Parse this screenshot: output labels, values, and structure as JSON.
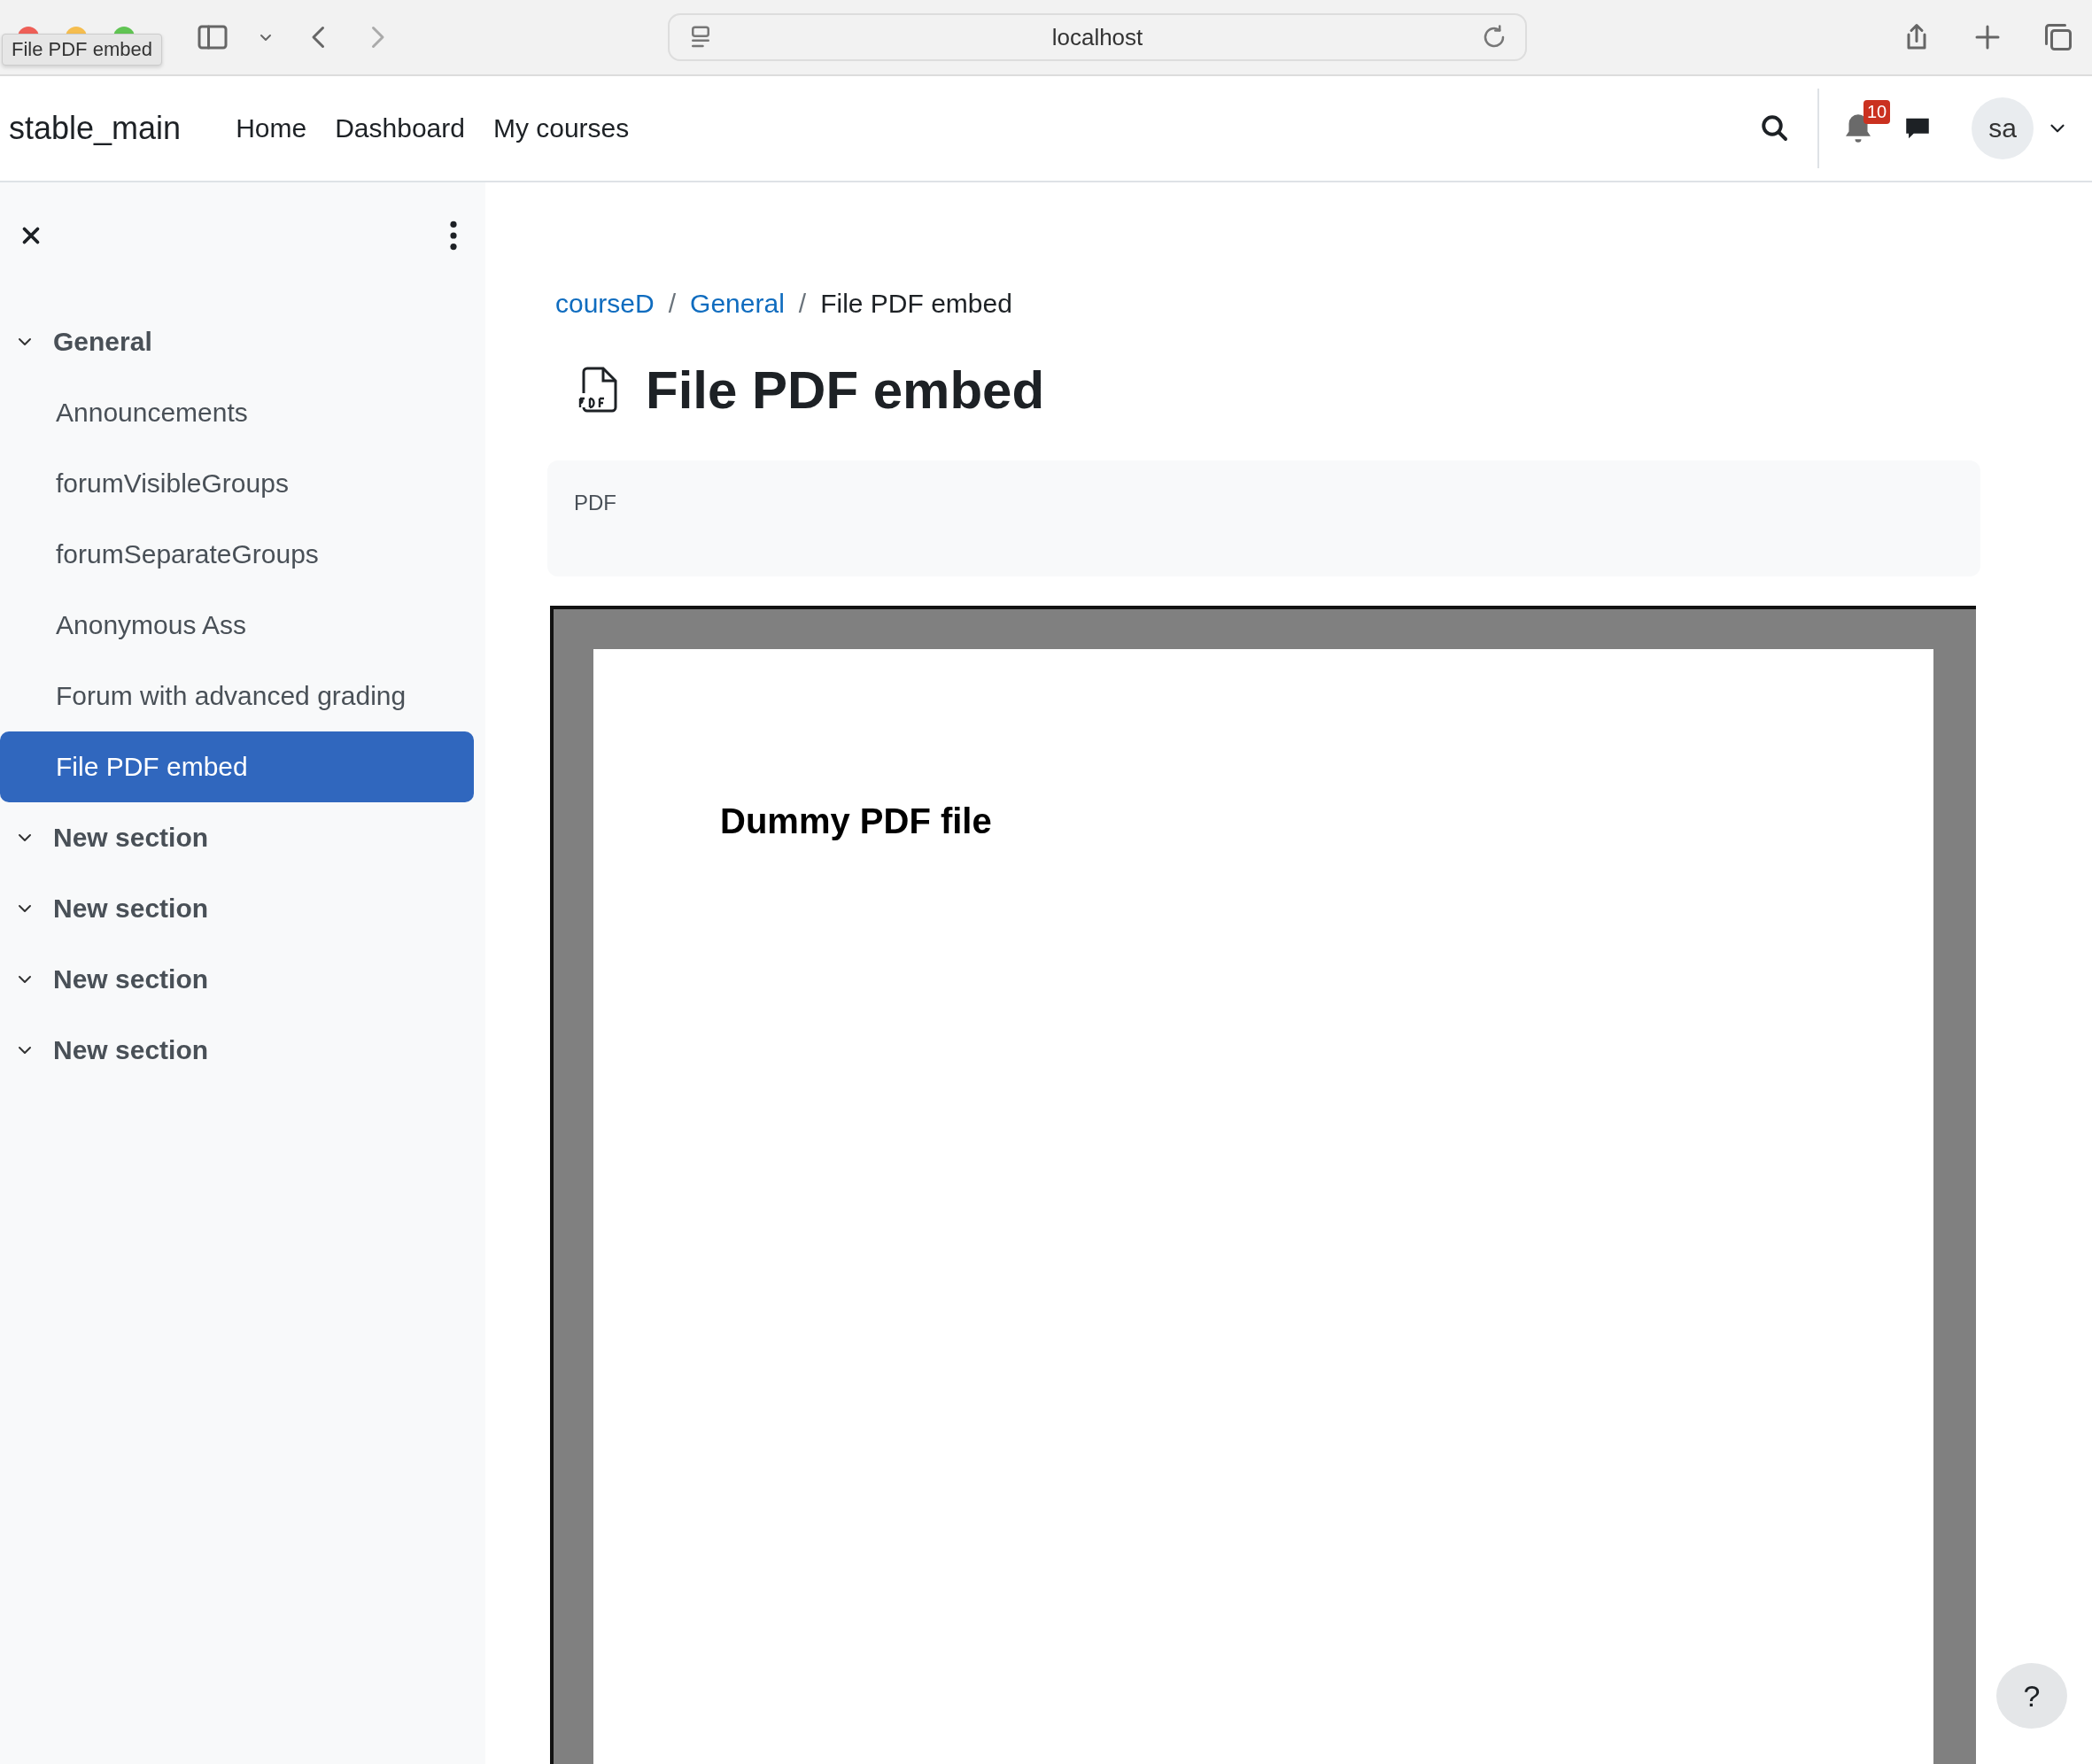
{
  "browser": {
    "address": "localhost",
    "tab_tooltip": "File PDF embed"
  },
  "navbar": {
    "brand": "stable_main",
    "links": [
      "Home",
      "Dashboard",
      "My courses"
    ],
    "notification_count": "10",
    "avatar": "sa"
  },
  "course_index": {
    "sections": [
      {
        "title": "General",
        "expanded": true,
        "items": [
          {
            "label": "Announcements",
            "selected": false
          },
          {
            "label": "forumVisibleGroups",
            "selected": false
          },
          {
            "label": "forumSeparateGroups",
            "selected": false
          },
          {
            "label": "Anonymous Ass",
            "selected": false
          },
          {
            "label": "Forum with advanced grading",
            "selected": false
          },
          {
            "label": "File PDF embed",
            "selected": true
          }
        ]
      },
      {
        "title": "New section",
        "expanded": true
      },
      {
        "title": "New section",
        "expanded": true
      },
      {
        "title": "New section",
        "expanded": true
      },
      {
        "title": "New section",
        "expanded": true
      }
    ]
  },
  "breadcrumb": [
    {
      "label": "courseD",
      "link": true
    },
    {
      "separator": "/",
      "label": "General",
      "link": true
    },
    {
      "separator": "/",
      "label": "File PDF embed",
      "link": false
    }
  ],
  "page": {
    "title": "File PDF embed",
    "description": "PDF",
    "embedded_document": {
      "heading": "Dummy PDF file"
    }
  },
  "help_button": "?"
}
